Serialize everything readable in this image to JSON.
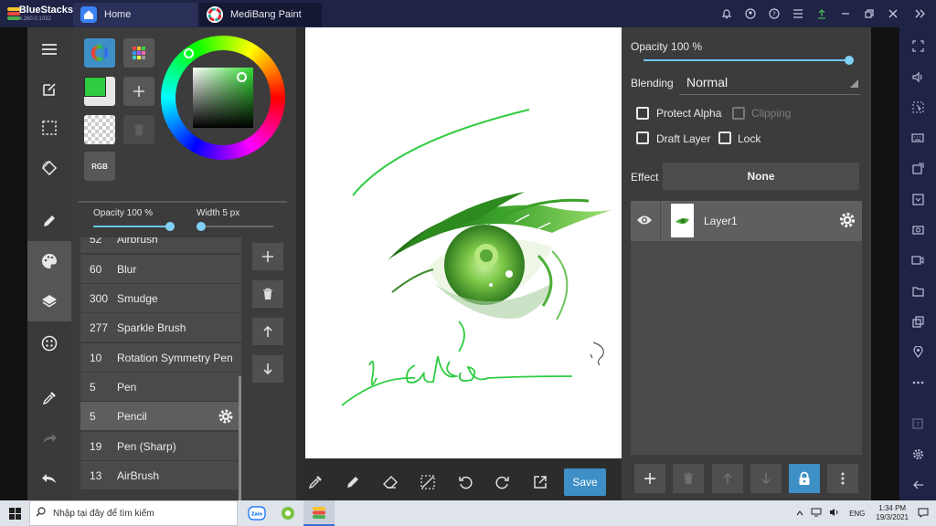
{
  "bluestacks": {
    "brand": "BlueStacks",
    "version": "4.260.0.1032",
    "tabs": [
      {
        "label": "Home"
      },
      {
        "label": "MediBang Paint"
      }
    ]
  },
  "color_panel": {
    "rgb_label": "RGB",
    "primary_color": "#2ecc40",
    "opacity_label": "Opacity 100 %",
    "opacity_value": 100,
    "width_label": "Width 5 px",
    "width_value": 5
  },
  "brushes": [
    {
      "size": "52",
      "name": "Airbrush"
    },
    {
      "size": "60",
      "name": "Blur"
    },
    {
      "size": "300",
      "name": "Smudge"
    },
    {
      "size": "277",
      "name": "Sparkle Brush"
    },
    {
      "size": "10",
      "name": "Rotation Symmetry Pen"
    },
    {
      "size": "5",
      "name": "Pen"
    },
    {
      "size": "5",
      "name": "Pencil",
      "selected": true
    },
    {
      "size": "19",
      "name": "Pen (Sharp)"
    },
    {
      "size": "13",
      "name": "AirBrush"
    }
  ],
  "canvas": {
    "save_label": "Save"
  },
  "layer_panel": {
    "opacity_label": "Opacity 100 %",
    "opacity_value": 100,
    "blending_label": "Blending",
    "blending_value": "Normal",
    "protect_alpha": "Protect Alpha",
    "clipping": "Clipping",
    "draft_layer": "Draft Layer",
    "lock": "Lock",
    "effect_label": "Effect",
    "effect_value": "None",
    "layers": [
      {
        "name": "Layer1",
        "visible": true
      }
    ]
  },
  "taskbar": {
    "search_placeholder": "Nhập tại đây để tìm kiếm",
    "language": "ENG",
    "time": "1:34 PM",
    "date": "19/3/2021"
  },
  "colors": {
    "accent": "#3d8fc6",
    "slider": "#6ec6f0",
    "stroke_green": "#2ecc40"
  }
}
